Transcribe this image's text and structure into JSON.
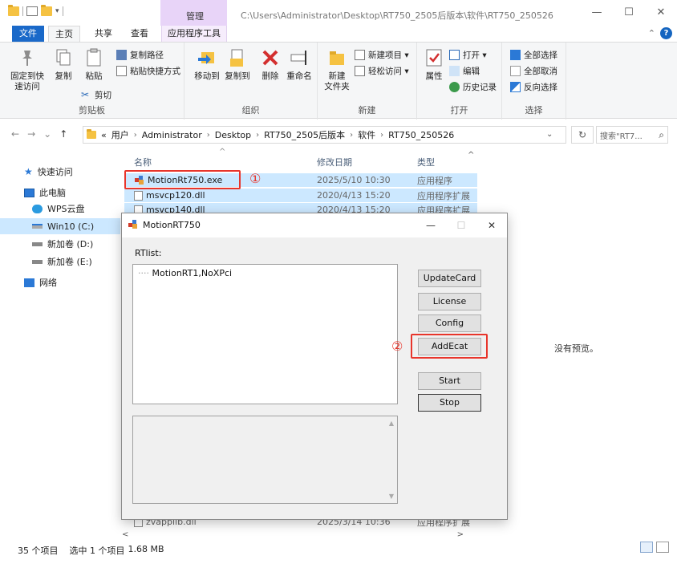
{
  "titlebar": {
    "manage_label": "管理",
    "path": "C:\\Users\\Administrator\\Desktop\\RT750_2505后版本\\软件\\RT750_250526",
    "minimize": "—",
    "maximize": "☐",
    "close": "✕"
  },
  "tabs": {
    "file": "文件",
    "home": "主页",
    "share": "共享",
    "view": "查看",
    "app_tools": "应用程序工具",
    "collapse": "⌃",
    "help": "?"
  },
  "ribbon": {
    "clipboard": {
      "label": "剪贴板",
      "pin": "固定到快\n速访问",
      "copy": "复制",
      "paste": "粘贴",
      "copy_path": "复制路径",
      "paste_shortcut": "粘贴快捷方式",
      "cut": "剪切"
    },
    "organize": {
      "label": "组织",
      "move_to": "移动到",
      "copy_to": "复制到",
      "delete": "删除",
      "rename": "重命名"
    },
    "new": {
      "label": "新建",
      "new_folder": "新建\n文件夹",
      "new_item": "新建项目 ▾",
      "easy_access": "轻松访问 ▾"
    },
    "open": {
      "label": "打开",
      "properties": "属性",
      "open": "打开 ▾",
      "edit": "编辑",
      "history": "历史记录"
    },
    "select": {
      "label": "选择",
      "select_all": "全部选择",
      "select_none": "全部取消",
      "invert": "反向选择"
    }
  },
  "nav": {
    "back": "←",
    "forward": "→",
    "recent": "⌄",
    "up": "↑",
    "prefix": "«",
    "crumbs": [
      "用户",
      "Administrator",
      "Desktop",
      "RT750_2505后版本",
      "软件",
      "RT750_250526"
    ],
    "crumb_sep": "›",
    "dropdown": "⌄",
    "refresh": "↻",
    "search_placeholder": "搜索\"RT7...",
    "search_icon": "⌕"
  },
  "navpane": {
    "items": [
      {
        "label": "快速访问",
        "icon": "star-icon"
      },
      {
        "label": "此电脑",
        "icon": "computer-icon"
      },
      {
        "label": "WPS云盘",
        "icon": "cloud-icon"
      },
      {
        "label": "Win10 (C:)",
        "icon": "drive-icon"
      },
      {
        "label": "新加卷 (D:)",
        "icon": "drive-icon"
      },
      {
        "label": "新加卷 (E:)",
        "icon": "drive-icon"
      },
      {
        "label": "网络",
        "icon": "network-icon"
      }
    ]
  },
  "filelist": {
    "headers": {
      "name": "名称",
      "date": "修改日期",
      "type": "类型"
    },
    "sort_indicator": "^",
    "rows": [
      {
        "name": "MotionRt750.exe",
        "date": "2025/5/10 10:30",
        "type": "应用程序"
      },
      {
        "name": "msvcp120.dll",
        "date": "2020/4/13 15:20",
        "type": "应用程序扩展"
      },
      {
        "name": "msvcp140.dll",
        "date": "2020/4/13 15:20",
        "type": "应用程序扩展"
      }
    ],
    "bottom_row": {
      "name": "zvapplib.dll",
      "date": "2025/3/14 10:36",
      "type": "应用程序扩展"
    },
    "scroll_up": "^",
    "scroll_down": "⌄"
  },
  "preview_text": "没有预览。",
  "hscroll": {
    "left": "<",
    "right": ">"
  },
  "status": {
    "count": "35 个项目",
    "selected": "选中 1 个项目",
    "size": "1.68 MB"
  },
  "annotations": {
    "one": "①",
    "two": "②",
    "color": "#e8352b"
  },
  "dialog": {
    "title": "MotionRT750",
    "minimize": "—",
    "maximize": "☐",
    "close": "✕",
    "rtlist_label": "RTlist:",
    "tree_item": "MotionRT1,NoXPci",
    "tree_prefix": "····",
    "buttons": {
      "update_card": "UpdateCard",
      "license": "License",
      "config": "Config",
      "add_ecat": "AddEcat",
      "start": "Start",
      "stop": "Stop"
    },
    "log_up": "▲",
    "log_down": "▼"
  }
}
